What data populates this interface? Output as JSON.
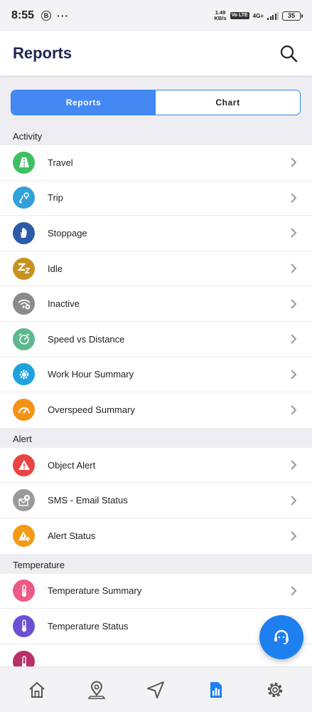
{
  "status_bar": {
    "time": "8:55",
    "b_badge": "B",
    "dots": "···",
    "net_speed_value": "1.49",
    "net_speed_unit": "KB/s",
    "volte": "Vo LTE",
    "network": "4G+",
    "battery": "35"
  },
  "header": {
    "title": "Reports"
  },
  "segment": {
    "reports_label": "Reports",
    "chart_label": "Chart",
    "active": "Reports"
  },
  "sections": [
    {
      "title": "Activity",
      "items": [
        {
          "label": "Travel",
          "icon": "road-icon",
          "color": "#3fbf63"
        },
        {
          "label": "Trip",
          "icon": "route-pin-icon",
          "color": "#2fa0da"
        },
        {
          "label": "Stoppage",
          "icon": "hand-stop-icon",
          "color": "#2b5aa8"
        },
        {
          "label": "Idle",
          "icon": "sleep-zz-icon",
          "color": "#c69321"
        },
        {
          "label": "Inactive",
          "icon": "wifi-off-icon",
          "color": "#8a8a8a"
        },
        {
          "label": "Speed vs Distance",
          "icon": "speed-distance-icon",
          "color": "#5cb88e"
        },
        {
          "label": "Work Hour Summary",
          "icon": "gear-clock-icon",
          "color": "#1fa3dc"
        },
        {
          "label": "Overspeed Summary",
          "icon": "speedometer-icon",
          "color": "#f39316"
        }
      ]
    },
    {
      "title": "Alert",
      "items": [
        {
          "label": "Object Alert",
          "icon": "warning-icon",
          "color": "#e94343"
        },
        {
          "label": "SMS - Email Status",
          "icon": "sms-email-icon",
          "color": "#9a9a9a"
        },
        {
          "label": "Alert Status",
          "icon": "alert-status-icon",
          "color": "#f39a17"
        }
      ]
    },
    {
      "title": "Temperature",
      "items": [
        {
          "label": "Temperature Summary",
          "icon": "thermometer-icon",
          "color": "#ec5b84"
        },
        {
          "label": "Temperature Status",
          "icon": "thermometer-status-icon",
          "color": "#6c4fd3"
        },
        {
          "label": "",
          "icon": "thermometer-icon",
          "color": "#b8306a"
        }
      ]
    }
  ],
  "fab": {
    "icon": "support-agent-icon",
    "color": "#1e7ff1"
  },
  "bottom_nav": [
    {
      "name": "home",
      "icon": "home-icon"
    },
    {
      "name": "location",
      "icon": "map-pin-icon"
    },
    {
      "name": "navigate",
      "icon": "navigation-arrow-icon"
    },
    {
      "name": "reports",
      "icon": "reports-icon",
      "active": true
    },
    {
      "name": "settings",
      "icon": "gear-icon"
    }
  ]
}
